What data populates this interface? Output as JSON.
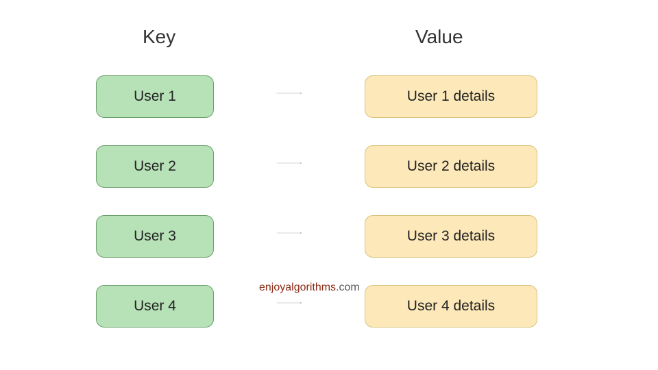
{
  "headers": {
    "key": "Key",
    "value": "Value"
  },
  "pairs": [
    {
      "key": "User 1",
      "value": "User 1 details"
    },
    {
      "key": "User 2",
      "value": "User 2 details"
    },
    {
      "key": "User 3",
      "value": "User 3 details"
    },
    {
      "key": "User 4",
      "value": "User 4 details"
    }
  ],
  "watermark": {
    "part1": "enjoyalgorithms",
    "part2": ".com"
  },
  "colors": {
    "key_fill": "#b7e1b6",
    "key_border": "#6aa06a",
    "value_fill": "#fce8b8",
    "value_border": "#d9c279",
    "arrow": "#808080"
  }
}
